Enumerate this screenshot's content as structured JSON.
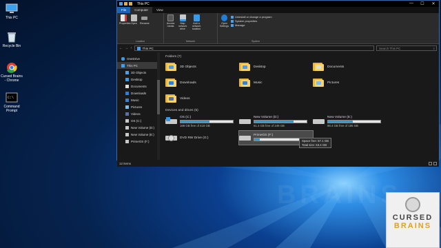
{
  "desktop": {
    "icons": [
      {
        "label": "This PC"
      },
      {
        "label": "Recycle Bin"
      },
      {
        "label": "Cursed Brains - Chrome"
      },
      {
        "label": "Command Prompt"
      }
    ],
    "watermark": "BRAINS"
  },
  "window": {
    "title": "This PC",
    "controls": {
      "minimize": "—",
      "maximize": "☐",
      "close": "✕"
    },
    "tabs": [
      {
        "label": "File"
      },
      {
        "label": "Computer"
      },
      {
        "label": "View"
      }
    ],
    "ribbon": {
      "location_buttons": [
        {
          "label": "Properties"
        },
        {
          "label": "Open"
        },
        {
          "label": "Rename"
        }
      ],
      "location_group": "Location",
      "network_buttons": [
        {
          "label": "Access media"
        },
        {
          "label": "Map network drive"
        },
        {
          "label": "Add a network location"
        }
      ],
      "network_group": "Network",
      "open_settings": "Open Settings",
      "system_items": [
        {
          "label": "Uninstall or change a program"
        },
        {
          "label": "System properties"
        },
        {
          "label": "Manage"
        }
      ],
      "system_group": "System"
    },
    "address": {
      "back": "←",
      "forward": "→",
      "up": "↑",
      "path": "This PC",
      "search_placeholder": "Search This PC"
    },
    "navpane": [
      {
        "label": "OneDrive"
      },
      {
        "label": "This PC"
      },
      {
        "label": "3D Objects"
      },
      {
        "label": "Desktop"
      },
      {
        "label": "Documents"
      },
      {
        "label": "Downloads"
      },
      {
        "label": "Music"
      },
      {
        "label": "Pictures"
      },
      {
        "label": "Videos"
      },
      {
        "label": "OS (C:)"
      },
      {
        "label": "New Volume (D:)"
      },
      {
        "label": "New Volume (E:)"
      },
      {
        "label": "PrimeOS (F:)"
      }
    ],
    "folders_heading": "Folders (7)",
    "folders": [
      {
        "label": "3D Objects",
        "color": "#4aa0e8"
      },
      {
        "label": "Desktop",
        "color": "#4aa0e8"
      },
      {
        "label": "Documents",
        "color": "#dddddd"
      },
      {
        "label": "Downloads",
        "color": "#2b7fd8"
      },
      {
        "label": "Music",
        "color": "#3a7fd0"
      },
      {
        "label": "Pictures",
        "color": "#7fbce8"
      },
      {
        "label": "Videos",
        "color": "#5a6fa8"
      }
    ],
    "drives_heading": "Devices and drives (5)",
    "drives": [
      {
        "label": "OS (C:)",
        "free": "188 GB free of 418 GB",
        "used_pct": 55
      },
      {
        "label": "New Volume (D:)",
        "free": "61.4 GB free of 249 GB",
        "used_pct": 75
      },
      {
        "label": "New Volume (E:)",
        "free": "98.4 GB free of 185 GB",
        "used_pct": 47
      },
      {
        "label": "DVD RW Drive (G:)",
        "free": "",
        "used_pct": null
      },
      {
        "label": "PrimeOS (F:)",
        "free": "",
        "used_pct": 10
      }
    ],
    "tooltip": {
      "line1": "Space free: 57.1 GB",
      "line2": "Total size: 63.4 GB"
    },
    "status": "12 items"
  },
  "logo": {
    "line1": "CURSED",
    "line2": "BRAINS"
  }
}
